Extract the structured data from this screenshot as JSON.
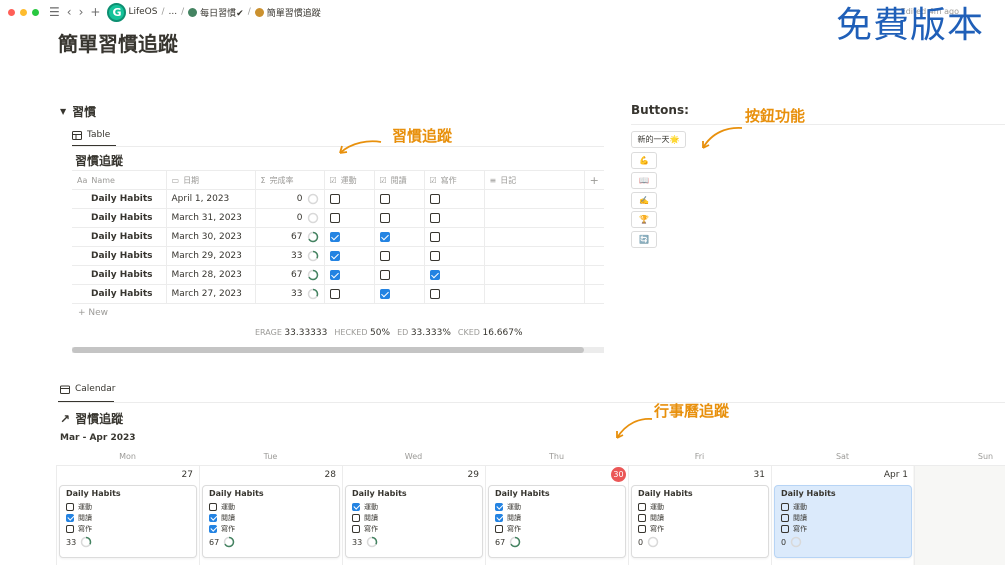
{
  "topbar": {
    "breadcrumbs": [
      "LifeOS",
      "...",
      "每日習慣✔",
      "簡單習慣追蹤"
    ],
    "edited": "Edited 4m ago",
    "colors": {
      "close": "#ff5f57",
      "min": "#febc2e",
      "max": "#28c840"
    }
  },
  "watermark": "免費版本",
  "page_title": "簡單習慣追蹤",
  "section": {
    "toggle_label": "習慣"
  },
  "table_view": {
    "tab_label": "Table",
    "db_title": "習慣追蹤",
    "columns": [
      "Name",
      "日期",
      "完成率",
      "運動",
      "閱讀",
      "寫作",
      "日記"
    ],
    "rows": [
      {
        "name": "Daily Habits",
        "date": "April 1, 2023",
        "pct": "0",
        "pct_value": 0,
        "ex": false,
        "read": false,
        "write": false
      },
      {
        "name": "Daily Habits",
        "date": "March 31, 2023",
        "pct": "0",
        "pct_value": 0,
        "ex": false,
        "read": false,
        "write": false
      },
      {
        "name": "Daily Habits",
        "date": "March 30, 2023",
        "pct": "67",
        "pct_value": 67,
        "ex": true,
        "read": true,
        "write": false
      },
      {
        "name": "Daily Habits",
        "date": "March 29, 2023",
        "pct": "33",
        "pct_value": 33,
        "ex": true,
        "read": false,
        "write": false
      },
      {
        "name": "Daily Habits",
        "date": "March 28, 2023",
        "pct": "67",
        "pct_value": 67,
        "ex": true,
        "read": false,
        "write": true
      },
      {
        "name": "Daily Habits",
        "date": "March 27, 2023",
        "pct": "33",
        "pct_value": 33,
        "ex": false,
        "read": true,
        "write": false
      }
    ],
    "new_label": "New",
    "calc": [
      {
        "label": "ERAGE",
        "value": "33.33333"
      },
      {
        "label": "HECKED",
        "value": "50%"
      },
      {
        "label": "ED",
        "value": "33.333%"
      },
      {
        "label": "CKED",
        "value": "16.667%"
      }
    ]
  },
  "buttons_panel": {
    "title": "Buttons:",
    "items": [
      {
        "label": "新的一天🌟"
      },
      {
        "label": "💪"
      },
      {
        "label": "📖"
      },
      {
        "label": "✍️"
      },
      {
        "label": "🏆"
      },
      {
        "label": "🔄"
      }
    ]
  },
  "annotations": {
    "habit": "習慣追蹤",
    "buttons": "按鈕功能",
    "calendar": "行事曆追蹤",
    "color": "#e8900c"
  },
  "calendar_view": {
    "tab_label": "Calendar",
    "title": "習慣追蹤",
    "month": "Mar - Apr 2023",
    "weekdays": [
      "Mon",
      "Tue",
      "Wed",
      "Thu",
      "Fri",
      "Sat",
      "Sun"
    ],
    "daynums": [
      "27",
      "28",
      "29",
      "30",
      "31",
      "Apr 1"
    ],
    "habit_labels": [
      "運動",
      "閱讀",
      "寫作"
    ],
    "cards": [
      {
        "title": "Daily Habits",
        "checks": [
          false,
          true,
          false
        ],
        "pct": "33",
        "pct_value": 33
      },
      {
        "title": "Daily Habits",
        "checks": [
          false,
          true,
          true
        ],
        "pct": "67",
        "pct_value": 67
      },
      {
        "title": "Daily Habits",
        "checks": [
          true,
          false,
          false
        ],
        "pct": "33",
        "pct_value": 33
      },
      {
        "title": "Daily Habits",
        "checks": [
          true,
          true,
          false
        ],
        "pct": "67",
        "pct_value": 67
      },
      {
        "title": "Daily Habits",
        "checks": [
          false,
          false,
          false
        ],
        "pct": "0",
        "pct_value": 0
      },
      {
        "title": "Daily Habits",
        "checks": [
          false,
          false,
          false
        ],
        "pct": "0",
        "pct_value": 0
      }
    ]
  }
}
